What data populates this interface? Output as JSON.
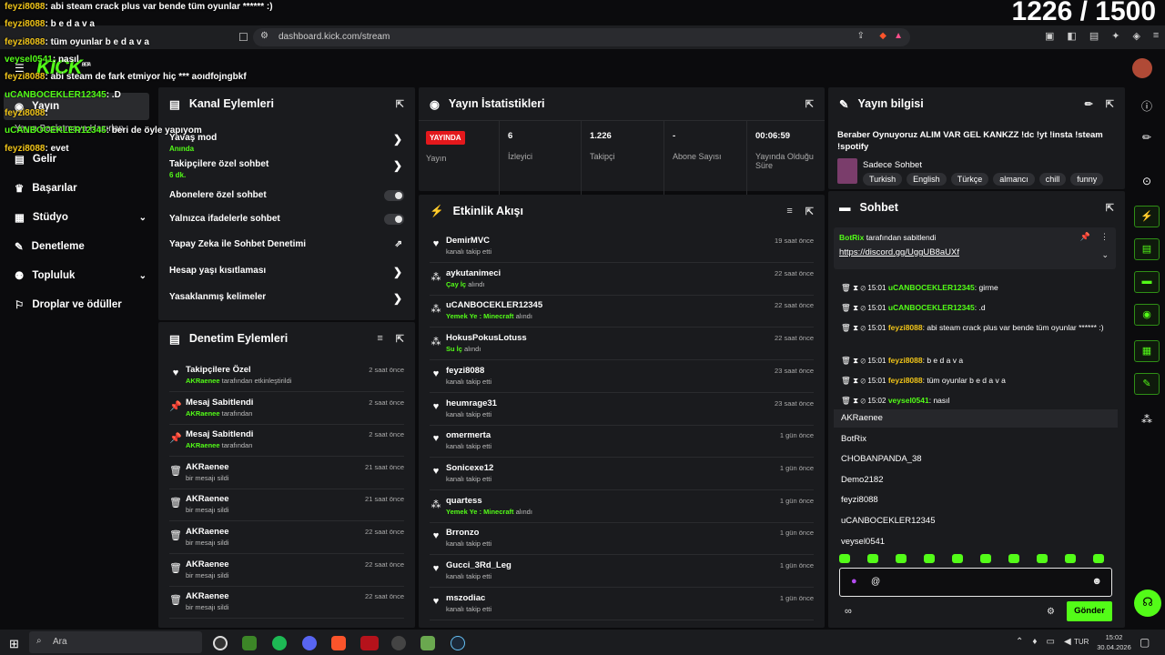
{
  "counter": "1226 / 1500",
  "browser": {
    "url": "dashboard.kick.com/stream"
  },
  "overlay_chat": [
    {
      "user": "feyzi8088",
      "text": ": abi steam crack plus var bende tüm oyunlar ****** :)"
    },
    {
      "user": "feyzi8088",
      "text": ": b e d a v a"
    },
    {
      "user": "feyzi8088",
      "text": ": tüm oyunlar b e d a v a"
    },
    {
      "user": "veysel0541",
      "text": ": nasıl"
    },
    {
      "user": "feyzi8088",
      "text": ": abi steam de fark etmiyor hiç *** aoıdfojngbkf"
    },
    {
      "user": "uCANBOCEKLER12345",
      "text": ": .D"
    },
    {
      "user": "feyzi8088",
      "text": ":"
    },
    {
      "user": "uCANBOCEKLER12345",
      "text": ": beri de öyle yapıyom"
    },
    {
      "user": "feyzi8088",
      "text": ": evet"
    }
  ],
  "logo": {
    "text": "KICK",
    "badge": "BETA"
  },
  "sidebar": {
    "items": [
      {
        "label": "Yayın"
      },
      {
        "label": "Yayın Başlatmaya Hazırlan"
      },
      {
        "label": "Gelir"
      },
      {
        "label": "Başarılar"
      },
      {
        "label": "Stüdyo"
      },
      {
        "label": "Denetleme"
      },
      {
        "label": "Topluluk"
      },
      {
        "label": "Droplar ve ödüller"
      }
    ]
  },
  "kanal": {
    "title": "Kanal Eylemleri",
    "items": [
      {
        "label": "Yavaş mod",
        "sub": "Anında"
      },
      {
        "label": "Takipçilere özel sohbet",
        "sub": "6 dk."
      },
      {
        "label": "Abonelere özel sohbet",
        "sub": ""
      },
      {
        "label": "Yalnızca ifadelerle sohbet",
        "sub": ""
      },
      {
        "label": "Yapay Zeka ile Sohbet Denetimi",
        "sub": ""
      },
      {
        "label": "Hesap yaşı kısıtlaması",
        "sub": ""
      },
      {
        "label": "Yasaklanmış kelimeler",
        "sub": ""
      }
    ]
  },
  "denetim": {
    "title": "Denetim Eylemleri",
    "rows": [
      {
        "name": "Takipçilere Özel",
        "who": "AKRaenee",
        "desc": "tarafından etkinleştirildi",
        "time": "2 saat önce"
      },
      {
        "name": "Mesaj Sabitlendi",
        "who": "AKRaenee",
        "desc": "tarafından",
        "time": "2 saat önce"
      },
      {
        "name": "Mesaj Sabitlendi",
        "who": "AKRaenee",
        "desc": "tarafından",
        "time": "2 saat önce"
      },
      {
        "name": "AKRaenee",
        "who": "",
        "desc": "bir mesajı sildi",
        "time": "21 saat önce"
      },
      {
        "name": "AKRaenee",
        "who": "",
        "desc": "bir mesajı sildi",
        "time": "21 saat önce"
      },
      {
        "name": "AKRaenee",
        "who": "",
        "desc": "bir mesajı sildi",
        "time": "22 saat önce"
      },
      {
        "name": "AKRaenee",
        "who": "",
        "desc": "bir mesajı sildi",
        "time": "22 saat önce"
      },
      {
        "name": "AKRaenee",
        "who": "",
        "desc": "bir mesajı sildi",
        "time": "22 saat önce"
      }
    ]
  },
  "stats": {
    "title": "Yayın İstatistikleri",
    "badge": "YAYINDA",
    "badge_label": "Yayın",
    "viewers": "6",
    "viewers_label": "İzleyici",
    "followers": "1.226",
    "followers_label": "Takipçi",
    "subs": "-",
    "subs_label": "Abone Sayısı",
    "uptime": "00:06:59",
    "uptime_label": "Yayında Olduğu Süre"
  },
  "etkinlik": {
    "title": "Etkinlik Akışı",
    "rows": [
      {
        "name": "DemirMVC",
        "hl": "",
        "desc": "kanalı takip etti",
        "time": "19 saat önce",
        "icon": "heart"
      },
      {
        "name": "aykutanimeci",
        "hl": "Çay İç",
        "desc": "alındı",
        "time": "22 saat önce",
        "icon": "kick"
      },
      {
        "name": "uCANBOCEKLER12345",
        "hl": "Yemek Ye : Minecraft",
        "desc": "alındı",
        "time": "22 saat önce",
        "icon": "kick"
      },
      {
        "name": "HokusPokusLotuss",
        "hl": "Su İç",
        "desc": "alındı",
        "time": "22 saat önce",
        "icon": "kick"
      },
      {
        "name": "feyzi8088",
        "hl": "",
        "desc": "kanalı takip etti",
        "time": "23 saat önce",
        "icon": "heart"
      },
      {
        "name": "heumrage31",
        "hl": "",
        "desc": "kanalı takip etti",
        "time": "23 saat önce",
        "icon": "heart"
      },
      {
        "name": "omermerta",
        "hl": "",
        "desc": "kanalı takip etti",
        "time": "1 gün önce",
        "icon": "heart"
      },
      {
        "name": "Sonicexe12",
        "hl": "",
        "desc": "kanalı takip etti",
        "time": "1 gün önce",
        "icon": "heart"
      },
      {
        "name": "quartess",
        "hl": "Yemek Ye : Minecraft",
        "desc": "alındı",
        "time": "1 gün önce",
        "icon": "kick"
      },
      {
        "name": "Brronzo",
        "hl": "",
        "desc": "kanalı takip etti",
        "time": "1 gün önce",
        "icon": "heart"
      },
      {
        "name": "Gucci_3Rd_Leg",
        "hl": "",
        "desc": "kanalı takip etti",
        "time": "1 gün önce",
        "icon": "heart"
      },
      {
        "name": "mszodiac",
        "hl": "",
        "desc": "kanalı takip etti",
        "time": "1 gün önce",
        "icon": "heart"
      }
    ]
  },
  "bilgi": {
    "title": "Yayın bilgisi",
    "stream_title": "Beraber Oynuyoruz ALIM VAR GEL KANKZZ !dc !yt !insta !steam !spotify",
    "category": "Sadece Sohbet",
    "tags": [
      "Turkish",
      "English",
      "Türkçe",
      "almancı",
      "chill",
      "funny"
    ]
  },
  "sohbet": {
    "title": "Sohbet",
    "pinned_user": "BotRix",
    "pinned_by": "tarafından sabitlendi",
    "pinned_link": "https://discord.gg/UggUB8aUXf",
    "messages": [
      {
        "time": "15:01",
        "user": "uCANBOCEKLER12345",
        "text": ": girme"
      },
      {
        "time": "15:01",
        "user": "uCANBOCEKLER12345",
        "text": ": .d"
      },
      {
        "time": "15:01",
        "user": "feyzi8088",
        "text": ": abi steam crack plus var bende tüm oyunlar ****** :)"
      },
      {
        "time": "15:01",
        "user": "feyzi8088",
        "text": ": b e d a v a"
      },
      {
        "time": "15:01",
        "user": "feyzi8088",
        "text": ": tüm oyunlar b e d a v a"
      },
      {
        "time": "15:02",
        "user": "veysel0541",
        "text": ": nasıl"
      }
    ],
    "mentions": [
      "AKRaenee",
      "BotRix",
      "CHOBANPANDA_38",
      "Demo2182",
      "feyzi8088",
      "uCANBOCEKLER12345",
      "veysel0541"
    ],
    "input_value": "@",
    "send_label": "Gönder"
  },
  "taskbar": {
    "search": "Ara",
    "lang": "TUR",
    "time": "15:02",
    "date": "30.04.2026"
  },
  "colors": {
    "accent": "#53fc18",
    "live": "#e4181c",
    "panel": "#1a1b1e"
  }
}
